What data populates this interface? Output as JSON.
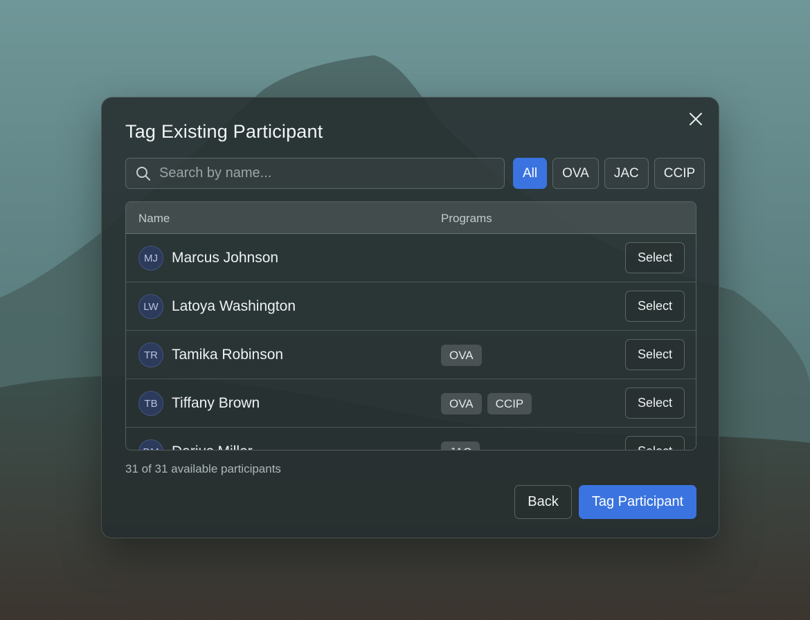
{
  "dialog": {
    "title": "Tag Existing Participant",
    "close_icon": "close-icon"
  },
  "search": {
    "placeholder": "Search by name...",
    "value": "",
    "icon": "search-icon"
  },
  "filters": [
    {
      "label": "All",
      "active": true
    },
    {
      "label": "OVA",
      "active": false
    },
    {
      "label": "JAC",
      "active": false
    },
    {
      "label": "CCIP",
      "active": false
    }
  ],
  "table": {
    "headers": {
      "name": "Name",
      "programs": "Programs"
    },
    "rows": [
      {
        "initials": "MJ",
        "name": "Marcus Johnson",
        "programs": [],
        "action": "Select"
      },
      {
        "initials": "LW",
        "name": "Latoya Washington",
        "programs": [],
        "action": "Select"
      },
      {
        "initials": "TR",
        "name": "Tamika Robinson",
        "programs": [
          "OVA"
        ],
        "action": "Select"
      },
      {
        "initials": "TB",
        "name": "Tiffany Brown",
        "programs": [
          "OVA",
          "CCIP"
        ],
        "action": "Select"
      },
      {
        "initials": "DM",
        "name": "Darius Miller",
        "programs": [
          "JAC"
        ],
        "action": "Select"
      }
    ]
  },
  "footer": {
    "count_text": "31 of 31 available participants",
    "back_label": "Back",
    "primary_label": "Tag Participant"
  },
  "colors": {
    "accent": "#3b74e0",
    "avatar_bg": "#2c3a5c",
    "tag_bg": "#4a5253"
  }
}
